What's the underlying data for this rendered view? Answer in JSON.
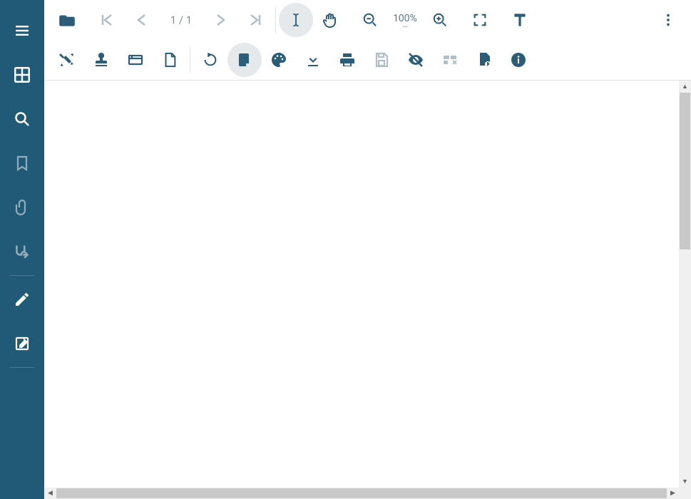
{
  "sidebar": {
    "items": [
      {
        "name": "menu",
        "dim": false
      },
      {
        "name": "thumbnails",
        "dim": false
      },
      {
        "name": "search",
        "dim": false
      },
      {
        "name": "bookmarks",
        "dim": true
      },
      {
        "name": "attachments",
        "dim": true
      },
      {
        "name": "flow",
        "dim": true
      },
      {
        "name": "edit",
        "dim": false
      },
      {
        "name": "annotate",
        "dim": false
      }
    ]
  },
  "toolbar": {
    "row1": {
      "open_label": "Open",
      "first_label": "First page",
      "prev_label": "Previous",
      "page_indicator": "1 / 1",
      "next_label": "Next",
      "last_label": "Last page",
      "select_text_label": "Select text",
      "pan_label": "Pan",
      "zoom_out_label": "Zoom out",
      "zoom_level": "100%",
      "zoom_in_label": "Zoom in",
      "fullscreen_label": "Fullscreen",
      "text_tool_label": "Text",
      "more_label": "More"
    },
    "row2": {
      "tools_label": "Drawing tools",
      "stamp_label": "Stamp",
      "form_label": "Form fields",
      "blank_label": "Blank page",
      "rotate_label": "Rotate",
      "page_view_label": "Page display",
      "theme_label": "Theme",
      "download_label": "Download",
      "print_label": "Print",
      "save_label": "Save",
      "visibility_label": "Hide annotations",
      "redact_label": "Redact",
      "export_label": "Export page",
      "info_label": "Document info"
    }
  },
  "icons": {
    "menu": "menu-icon",
    "thumbnails": "grid-icon",
    "search": "search-icon",
    "bookmarks": "bookmark-icon",
    "attachments": "paperclip-icon",
    "flow": "reflow-icon",
    "edit": "pencil-icon",
    "annotate": "edit-note-icon"
  },
  "colors": {
    "sidebar_bg": "#215a77",
    "icon_primary": "#2b5d78",
    "icon_disabled": "#b0bfc7",
    "active_bg": "#e5e9eb"
  }
}
